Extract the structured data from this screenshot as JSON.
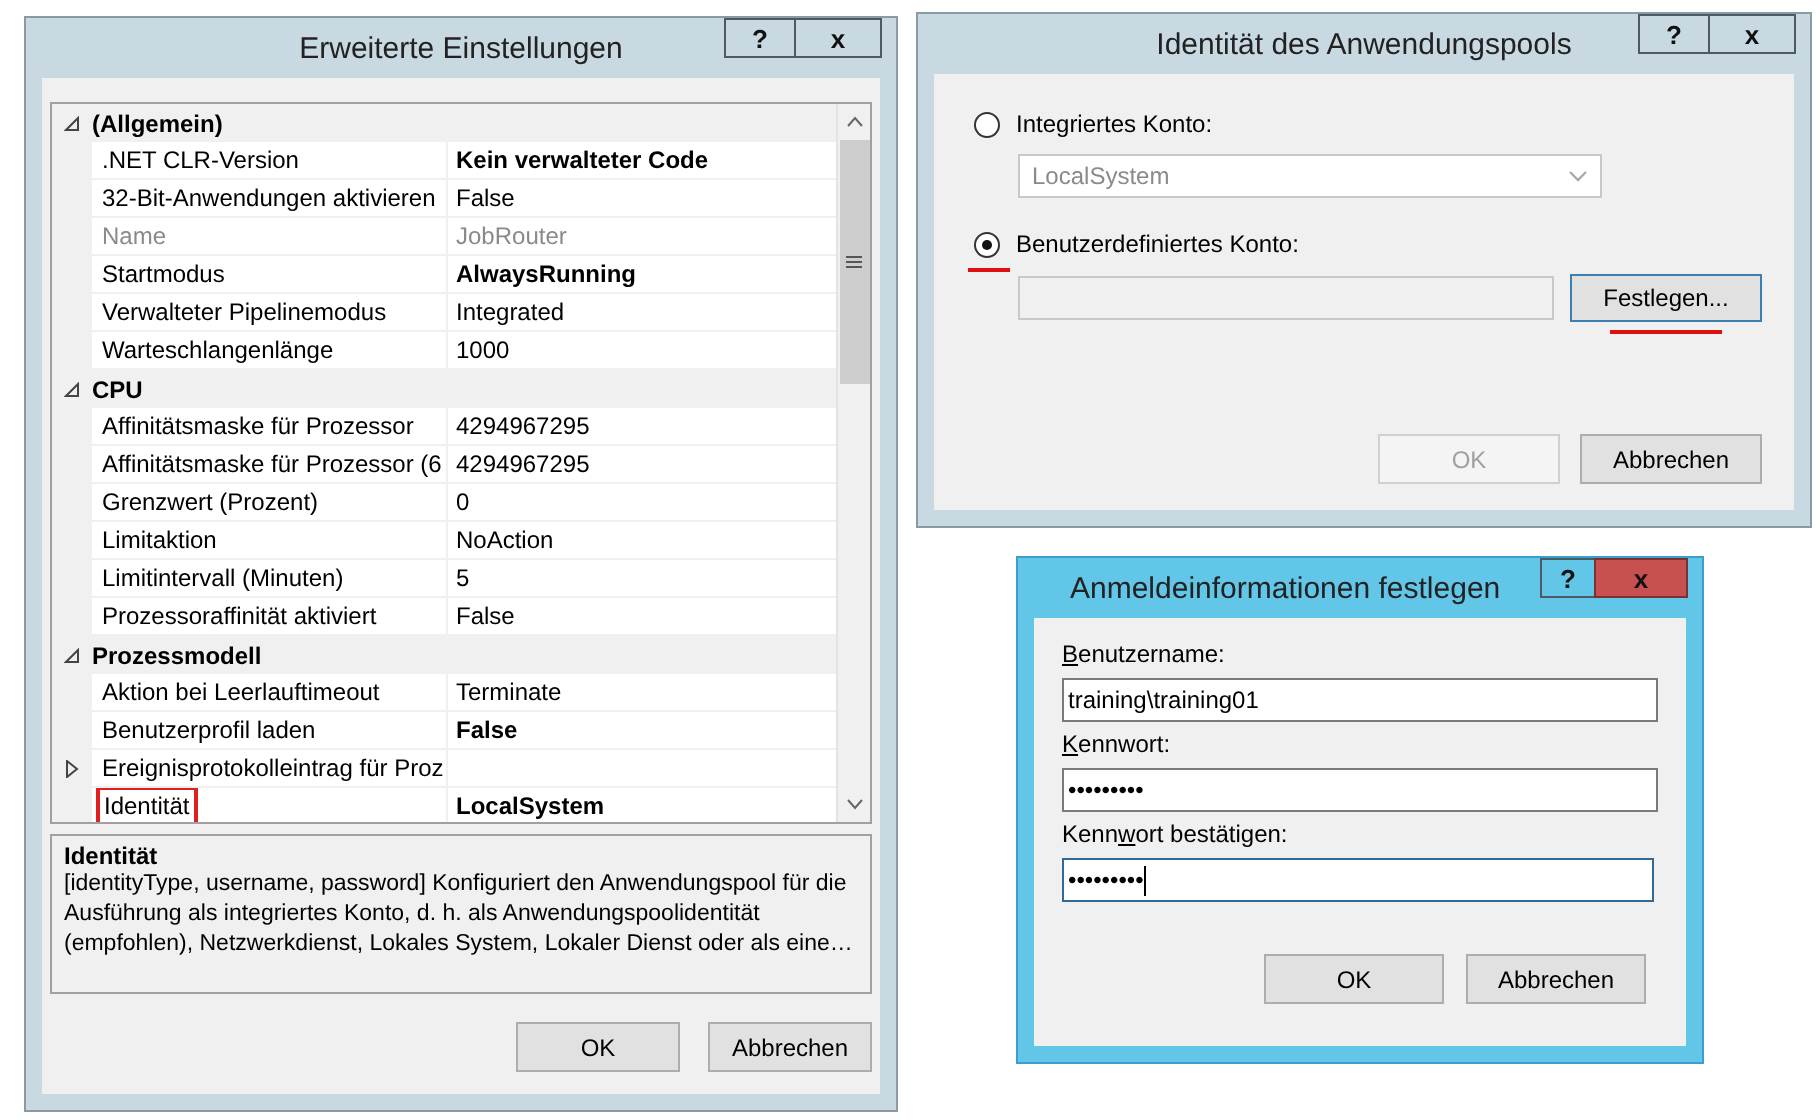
{
  "settings_dialog": {
    "title": "Erweiterte Einstellungen",
    "active": false,
    "title_buttons": [
      "?",
      "x"
    ],
    "groups": [
      {
        "label": "(Allgemein)",
        "expanded": true,
        "properties": [
          {
            "name": ".NET CLR-Version",
            "value": "Kein verwalteter Code",
            "bold": true,
            "disabled": false,
            "highlighted": false
          },
          {
            "name": "32-Bit-Anwendungen aktivieren",
            "value": "False",
            "bold": false,
            "disabled": false,
            "highlighted": false
          },
          {
            "name": "Name",
            "value": "JobRouter",
            "bold": false,
            "disabled": true,
            "highlighted": false
          },
          {
            "name": "Startmodus",
            "value": "AlwaysRunning",
            "bold": true,
            "disabled": false,
            "highlighted": false
          },
          {
            "name": "Verwalteter Pipelinemodus",
            "value": "Integrated",
            "bold": false,
            "disabled": false,
            "highlighted": false
          },
          {
            "name": "Warteschlangenlänge",
            "value": "1000",
            "bold": false,
            "disabled": false,
            "highlighted": false
          }
        ]
      },
      {
        "label": "CPU",
        "expanded": true,
        "properties": [
          {
            "name": "Affinitätsmaske für Prozessor",
            "value": "4294967295",
            "bold": false,
            "disabled": false,
            "highlighted": false
          },
          {
            "name": "Affinitätsmaske für Prozessor (6",
            "value": "4294967295",
            "bold": false,
            "disabled": false,
            "highlighted": false
          },
          {
            "name": "Grenzwert (Prozent)",
            "value": "0",
            "bold": false,
            "disabled": false,
            "highlighted": false
          },
          {
            "name": "Limitaktion",
            "value": "NoAction",
            "bold": false,
            "disabled": false,
            "highlighted": false
          },
          {
            "name": "Limitintervall (Minuten)",
            "value": "5",
            "bold": false,
            "disabled": false,
            "highlighted": false
          },
          {
            "name": "Prozessoraffinität aktiviert",
            "value": "False",
            "bold": false,
            "disabled": false,
            "highlighted": false
          }
        ]
      },
      {
        "label": "Prozessmodell",
        "expanded": true,
        "properties": [
          {
            "name": "Aktion bei Leerlauftimeout",
            "value": "Terminate",
            "bold": false,
            "disabled": false,
            "highlighted": false
          },
          {
            "name": "Benutzerprofil laden",
            "value": "False",
            "bold": true,
            "disabled": false,
            "highlighted": false
          },
          {
            "name": "Ereignisprotokolleintrag für Proz",
            "disabled": false,
            "highlighted": false,
            "expanded": false
          },
          {
            "name": "Identität",
            "value": "LocalSystem",
            "bold": true,
            "disabled": false,
            "highlighted": true
          }
        ]
      }
    ],
    "description": {
      "title": "Identität",
      "text": "[identityType, username, password] Konfiguriert den Anwendungspool für die Ausführung als integriertes Konto, d. h. als Anwendungspoolidentität (empfohlen), Netzwerkdienst, Lokales System, Lokaler Dienst oder als eine…"
    },
    "buttons": [
      {
        "label": "OK",
        "disabled": false
      },
      {
        "label": "Abbrechen",
        "disabled": false
      }
    ]
  },
  "identity_dialog": {
    "title": "Identität des Anwendungspools",
    "active": false,
    "title_buttons": [
      "?",
      "x"
    ],
    "options": [
      {
        "label": "Integriertes Konto:",
        "selected": false,
        "kind": "dropdown",
        "value": "LocalSystem",
        "disabled": true
      },
      {
        "label": "Benutzerdefiniertes Konto:",
        "selected": true,
        "marked": true,
        "kind": "account",
        "button": {
          "label": "Festlegen...",
          "marked": true
        }
      }
    ],
    "buttons": [
      {
        "label": "OK",
        "disabled": true
      },
      {
        "label": "Abbrechen",
        "disabled": false
      }
    ]
  },
  "credentials_dialog": {
    "title": "Anmeldeinformationen festlegen",
    "active": true,
    "title_buttons": [
      "?",
      "x"
    ],
    "fields": [
      {
        "label": {
          "key": "B",
          "after": "enutzername:"
        },
        "value": "training\\training01",
        "focused": false
      },
      {
        "label": {
          "key": "K",
          "after": "ennwort:"
        },
        "value": "•••••••••",
        "focused": false
      },
      {
        "label": {
          "before": "Kenn",
          "key": "w",
          "after": "ort bestätigen:"
        },
        "value": "•••••••••",
        "focused": true
      }
    ],
    "buttons": [
      {
        "label": "OK",
        "disabled": false
      },
      {
        "label": "Abbrechen",
        "disabled": false
      }
    ]
  }
}
